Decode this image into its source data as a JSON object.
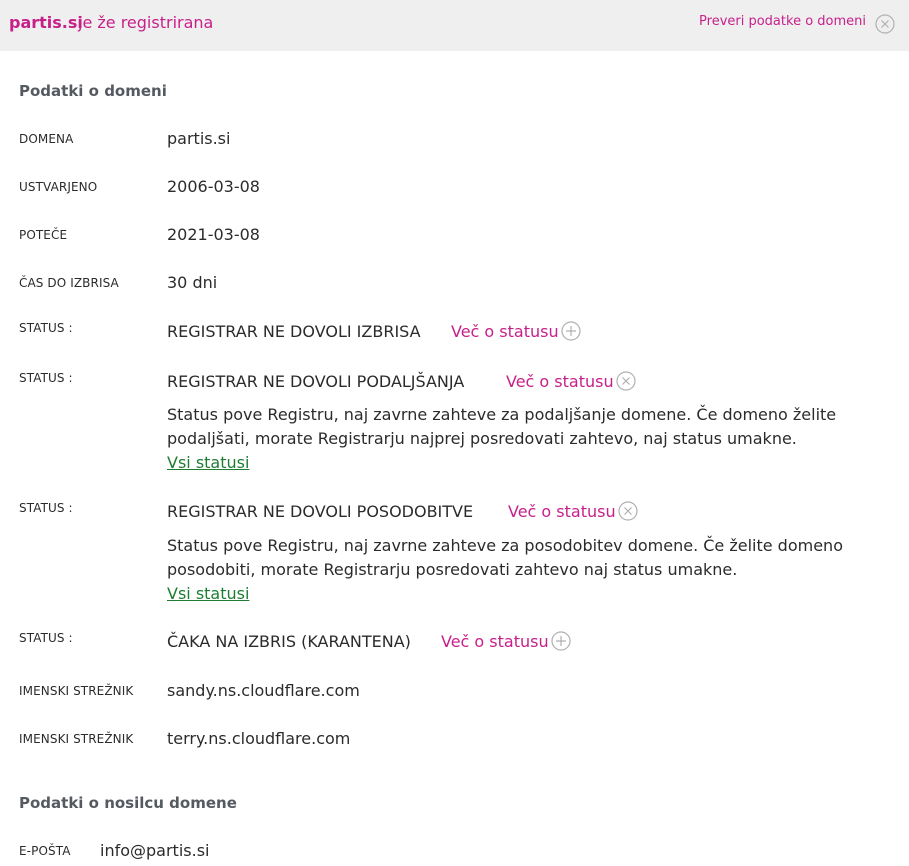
{
  "header": {
    "domain": "partis.si",
    "message": "je že registrirana",
    "check_link": "Preveri podatke o domeni"
  },
  "domain_info": {
    "title": "Podatki o domeni",
    "rows": [
      {
        "label": "DOMENA",
        "value": "partis.si"
      },
      {
        "label": "USTVARJENO",
        "value": "2006-03-08"
      },
      {
        "label": "POTEČE",
        "value": "2021-03-08"
      },
      {
        "label": "ČAS DO IZBRISA",
        "value": "30 dni"
      }
    ],
    "statuses": [
      {
        "label": "STATUS :",
        "value": "REGISTRAR NE DOVOLI IZBRISA",
        "more": "Več o statusu",
        "expanded": false
      },
      {
        "label": "STATUS :",
        "value": "REGISTRAR NE DOVOLI PODALJŠANJA",
        "more": "Več o statusu",
        "expanded": true,
        "description": "Status pove Registru, naj zavrne zahteve za podaljšanje domene. Če domeno želite podaljšati, morate Registrarju najprej posredovati zahtevo, naj status umakne.",
        "all_link": "Vsi statusi"
      },
      {
        "label": "STATUS :",
        "value": "REGISTRAR NE DOVOLI POSODOBITVE",
        "more": "Več o statusu",
        "expanded": true,
        "description": "Status pove Registru, naj zavrne zahteve za posodobitev domene. Če želite domeno posodobiti, morate Registrarju posredovati zahtevo naj status umakne.",
        "all_link": "Vsi statusi"
      },
      {
        "label": "STATUS :",
        "value": "ČAKA NA IZBRIS (KARANTENA)",
        "more": "Več o statusu",
        "expanded": false
      }
    ],
    "nameservers": [
      {
        "label": "IMENSKI STREŽNIK",
        "value": "sandy.ns.cloudflare.com"
      },
      {
        "label": "IMENSKI STREŽNIK",
        "value": "terry.ns.cloudflare.com"
      }
    ]
  },
  "holder_info": {
    "title": "Podatki o nosilcu domene",
    "email_label": "E-POŠTA",
    "email_value": "info@partis.si"
  },
  "colors": {
    "accent": "#c8208a",
    "link_green": "#1e7d32",
    "header_bg": "#efefef"
  }
}
